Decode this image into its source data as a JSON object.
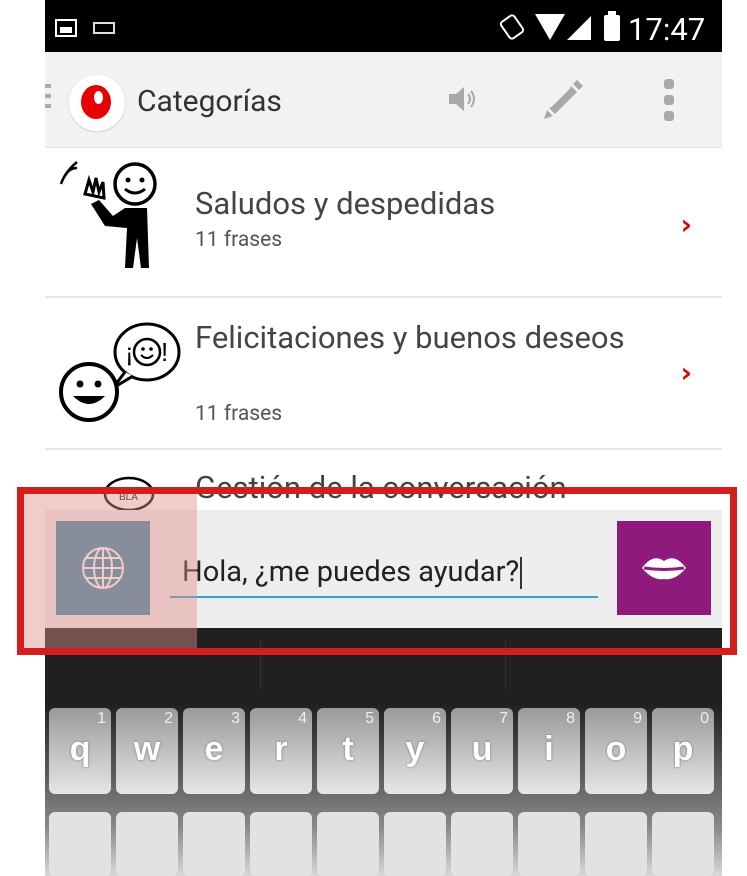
{
  "status_bar": {
    "time": "17:47",
    "icons": [
      "image-icon",
      "keyboard-icon",
      "rotation-icon",
      "wifi-icon",
      "signal-icon",
      "battery-icon"
    ]
  },
  "action_bar": {
    "title": "Categorías",
    "logo": "vodafone-logo",
    "actions": [
      "speaker-icon",
      "pencil-icon",
      "overflow-menu-icon"
    ]
  },
  "categories": [
    {
      "title": "Saludos y despedidas",
      "count": "11 frases",
      "icon": "waving-person-icon"
    },
    {
      "title": "Felicitaciones y buenos deseos",
      "count": "11 frases",
      "icon": "happy-faces-icon"
    },
    {
      "title": "Gestión de la conversación",
      "count": "",
      "icon": "talking-face-icon"
    }
  ],
  "phrase_bar": {
    "text": "Hola, ¿me puedes ayudar?",
    "left_button": "globe-icon",
    "right_button": "lips-icon"
  },
  "keyboard": {
    "top_row": [
      {
        "char": "q",
        "num": "1"
      },
      {
        "char": "w",
        "num": "2"
      },
      {
        "char": "e",
        "num": "3"
      },
      {
        "char": "r",
        "num": "4"
      },
      {
        "char": "t",
        "num": "5"
      },
      {
        "char": "y",
        "num": "6"
      },
      {
        "char": "u",
        "num": "7"
      },
      {
        "char": "i",
        "num": "8"
      },
      {
        "char": "o",
        "num": "9"
      },
      {
        "char": "p",
        "num": "0"
      }
    ]
  },
  "colors": {
    "accent_red": "#e60000",
    "globe_button": "#3f8eaa",
    "lips_button": "#8e1a7c",
    "highlight": "#d41e1e",
    "input_underline": "#35a0c8"
  }
}
